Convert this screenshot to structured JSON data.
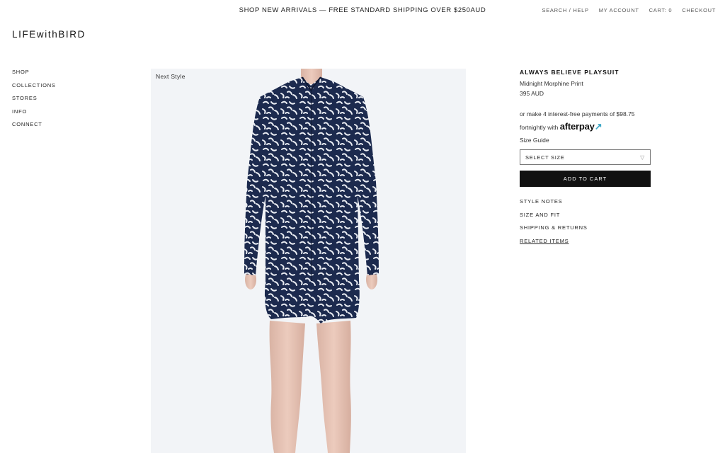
{
  "header": {
    "promo": "SHOP NEW ARRIVALS — FREE STANDARD SHIPPING OVER $250AUD",
    "utility": [
      "SEARCH / HELP",
      "MY ACCOUNT",
      "CART: 0",
      "CHECKOUT"
    ],
    "logo": "LIFEwithBIRD"
  },
  "sidenav": [
    "SHOP",
    "COLLECTIONS",
    "STORES",
    "INFO",
    "CONNECT"
  ],
  "gallery": {
    "next_style": "Next Style",
    "print_color": "#1c2a4e"
  },
  "product": {
    "title": "ALWAYS BELIEVE PLAYSUIT",
    "variant": "Midnight Morphine Print",
    "price": "395 AUD",
    "afterpay_text_1": "or make 4 interest-free payments of $98.75",
    "afterpay_text_2": "fortnightly with",
    "afterpay_logo": "afterpay",
    "size_guide": "Size Guide",
    "select_size": "SELECT SIZE",
    "add_to_cart": "ADD TO CART",
    "links": [
      "STYLE NOTES",
      "SIZE AND FIT",
      "SHIPPING & RETURNS",
      "RELATED ITEMS"
    ]
  }
}
